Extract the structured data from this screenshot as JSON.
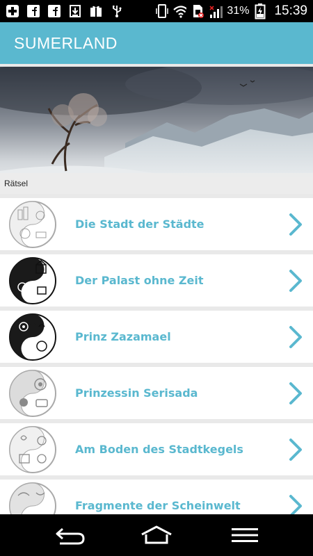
{
  "status_bar": {
    "battery_pct": "31%",
    "time": "15:39",
    "icons": [
      "add-icon",
      "facebook-icon",
      "facebook-icon",
      "download-icon",
      "gift-icon",
      "usb-icon",
      "phone-vibrate-icon",
      "wifi-icon",
      "sim-icon",
      "signal-icon",
      "battery-icon"
    ]
  },
  "app_bar": {
    "title": "SUMERLAND"
  },
  "hero": {
    "caption": "Rätsel"
  },
  "list": {
    "items": [
      {
        "label": "Die Stadt der Städte",
        "icon": "city-emblem-icon",
        "tone": "light"
      },
      {
        "label": "Der Palast ohne Zeit",
        "icon": "palace-emblem-icon",
        "tone": "dark"
      },
      {
        "label": "Prinz Zazamael",
        "icon": "prince-emblem-icon",
        "tone": "dark"
      },
      {
        "label": "Prinzessin Serisada",
        "icon": "princess-emblem-icon",
        "tone": "light"
      },
      {
        "label": "Am Boden des Stadtkegels",
        "icon": "cone-emblem-icon",
        "tone": "light"
      },
      {
        "label": "Fragmente der Scheinwelt",
        "icon": "fragments-emblem-icon",
        "tone": "light"
      }
    ]
  },
  "colors": {
    "accent": "#5ab8cf",
    "row_bg": "#ffffff",
    "separator": "#e9e9e9"
  },
  "nav_bar": {
    "icons": [
      "back-icon",
      "home-icon",
      "menu-icon"
    ]
  }
}
